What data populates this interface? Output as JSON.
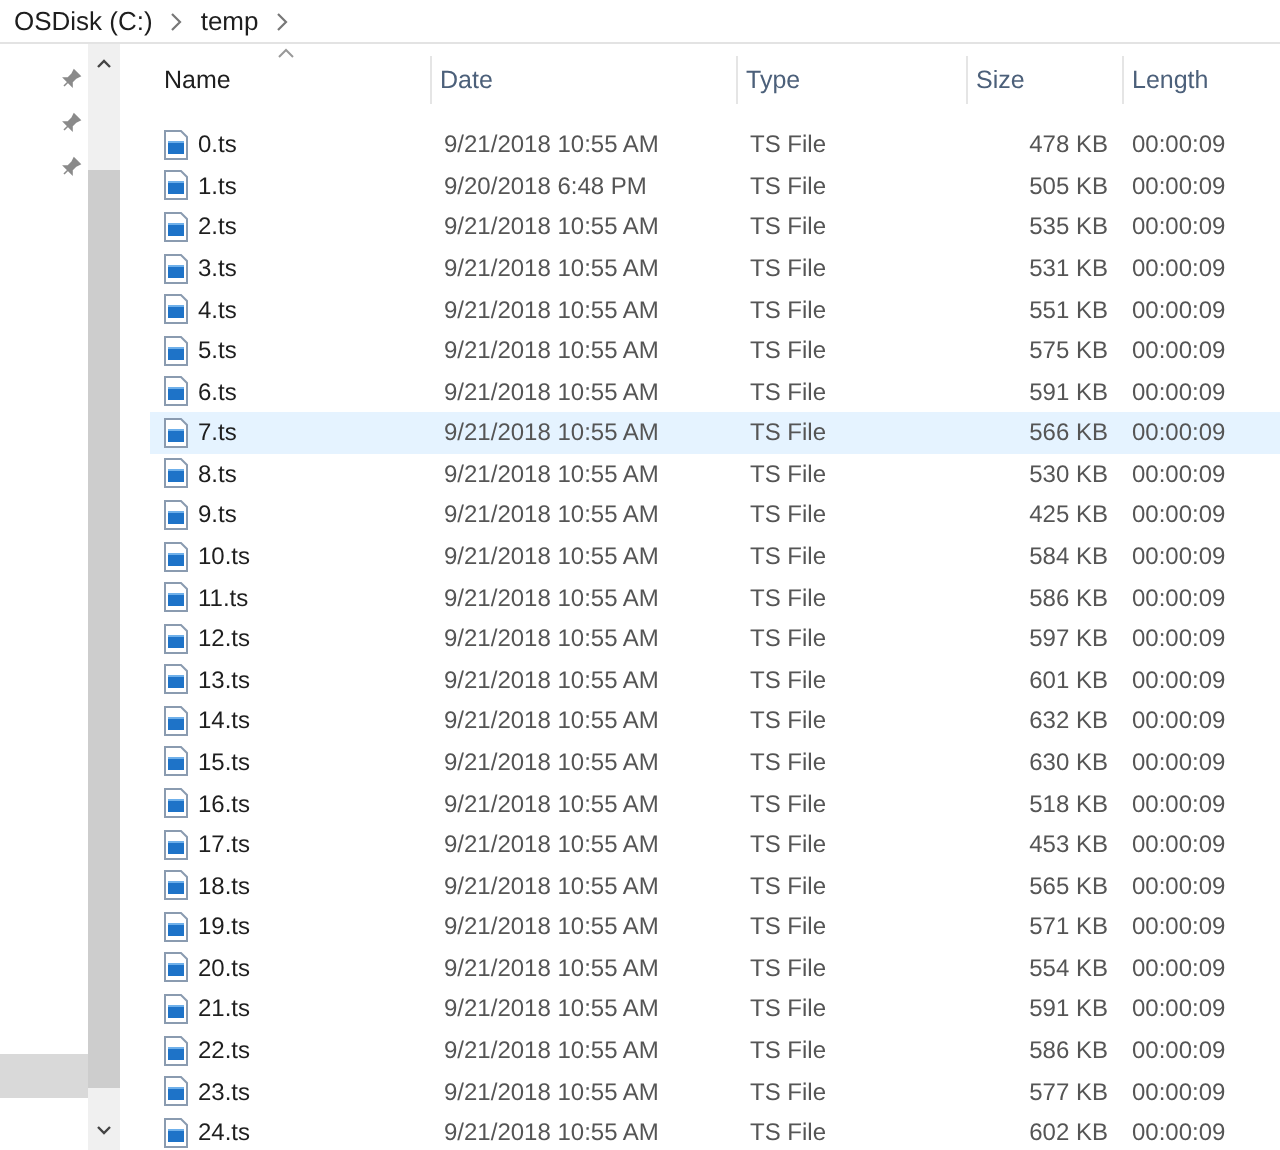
{
  "breadcrumb": {
    "items": [
      {
        "label": "OSDisk (C:)"
      },
      {
        "label": "temp"
      }
    ]
  },
  "table": {
    "columns": [
      {
        "label": "Name",
        "sorted": true
      },
      {
        "label": "Date",
        "sorted": false
      },
      {
        "label": "Type",
        "sorted": false
      },
      {
        "label": "Size",
        "sorted": false
      },
      {
        "label": "Length",
        "sorted": false
      }
    ],
    "rows": [
      {
        "name": "0.ts",
        "date": "9/21/2018 10:55 AM",
        "type": "TS File",
        "size": "478 KB",
        "length": "00:00:09",
        "selected": false
      },
      {
        "name": "1.ts",
        "date": "9/20/2018 6:48 PM",
        "type": "TS File",
        "size": "505 KB",
        "length": "00:00:09",
        "selected": false
      },
      {
        "name": "2.ts",
        "date": "9/21/2018 10:55 AM",
        "type": "TS File",
        "size": "535 KB",
        "length": "00:00:09",
        "selected": false
      },
      {
        "name": "3.ts",
        "date": "9/21/2018 10:55 AM",
        "type": "TS File",
        "size": "531 KB",
        "length": "00:00:09",
        "selected": false
      },
      {
        "name": "4.ts",
        "date": "9/21/2018 10:55 AM",
        "type": "TS File",
        "size": "551 KB",
        "length": "00:00:09",
        "selected": false
      },
      {
        "name": "5.ts",
        "date": "9/21/2018 10:55 AM",
        "type": "TS File",
        "size": "575 KB",
        "length": "00:00:09",
        "selected": false
      },
      {
        "name": "6.ts",
        "date": "9/21/2018 10:55 AM",
        "type": "TS File",
        "size": "591 KB",
        "length": "00:00:09",
        "selected": false
      },
      {
        "name": "7.ts",
        "date": "9/21/2018 10:55 AM",
        "type": "TS File",
        "size": "566 KB",
        "length": "00:00:09",
        "selected": true
      },
      {
        "name": "8.ts",
        "date": "9/21/2018 10:55 AM",
        "type": "TS File",
        "size": "530 KB",
        "length": "00:00:09",
        "selected": false
      },
      {
        "name": "9.ts",
        "date": "9/21/2018 10:55 AM",
        "type": "TS File",
        "size": "425 KB",
        "length": "00:00:09",
        "selected": false
      },
      {
        "name": "10.ts",
        "date": "9/21/2018 10:55 AM",
        "type": "TS File",
        "size": "584 KB",
        "length": "00:00:09",
        "selected": false
      },
      {
        "name": "11.ts",
        "date": "9/21/2018 10:55 AM",
        "type": "TS File",
        "size": "586 KB",
        "length": "00:00:09",
        "selected": false
      },
      {
        "name": "12.ts",
        "date": "9/21/2018 10:55 AM",
        "type": "TS File",
        "size": "597 KB",
        "length": "00:00:09",
        "selected": false
      },
      {
        "name": "13.ts",
        "date": "9/21/2018 10:55 AM",
        "type": "TS File",
        "size": "601 KB",
        "length": "00:00:09",
        "selected": false
      },
      {
        "name": "14.ts",
        "date": "9/21/2018 10:55 AM",
        "type": "TS File",
        "size": "632 KB",
        "length": "00:00:09",
        "selected": false
      },
      {
        "name": "15.ts",
        "date": "9/21/2018 10:55 AM",
        "type": "TS File",
        "size": "630 KB",
        "length": "00:00:09",
        "selected": false
      },
      {
        "name": "16.ts",
        "date": "9/21/2018 10:55 AM",
        "type": "TS File",
        "size": "518 KB",
        "length": "00:00:09",
        "selected": false
      },
      {
        "name": "17.ts",
        "date": "9/21/2018 10:55 AM",
        "type": "TS File",
        "size": "453 KB",
        "length": "00:00:09",
        "selected": false
      },
      {
        "name": "18.ts",
        "date": "9/21/2018 10:55 AM",
        "type": "TS File",
        "size": "565 KB",
        "length": "00:00:09",
        "selected": false
      },
      {
        "name": "19.ts",
        "date": "9/21/2018 10:55 AM",
        "type": "TS File",
        "size": "571 KB",
        "length": "00:00:09",
        "selected": false
      },
      {
        "name": "20.ts",
        "date": "9/21/2018 10:55 AM",
        "type": "TS File",
        "size": "554 KB",
        "length": "00:00:09",
        "selected": false
      },
      {
        "name": "21.ts",
        "date": "9/21/2018 10:55 AM",
        "type": "TS File",
        "size": "591 KB",
        "length": "00:00:09",
        "selected": false
      },
      {
        "name": "22.ts",
        "date": "9/21/2018 10:55 AM",
        "type": "TS File",
        "size": "586 KB",
        "length": "00:00:09",
        "selected": false
      },
      {
        "name": "23.ts",
        "date": "9/21/2018 10:55 AM",
        "type": "TS File",
        "size": "577 KB",
        "length": "00:00:09",
        "selected": false
      },
      {
        "name": "24.ts",
        "date": "9/21/2018 10:55 AM",
        "type": "TS File",
        "size": "602 KB",
        "length": "00:00:09",
        "selected": false
      }
    ]
  }
}
